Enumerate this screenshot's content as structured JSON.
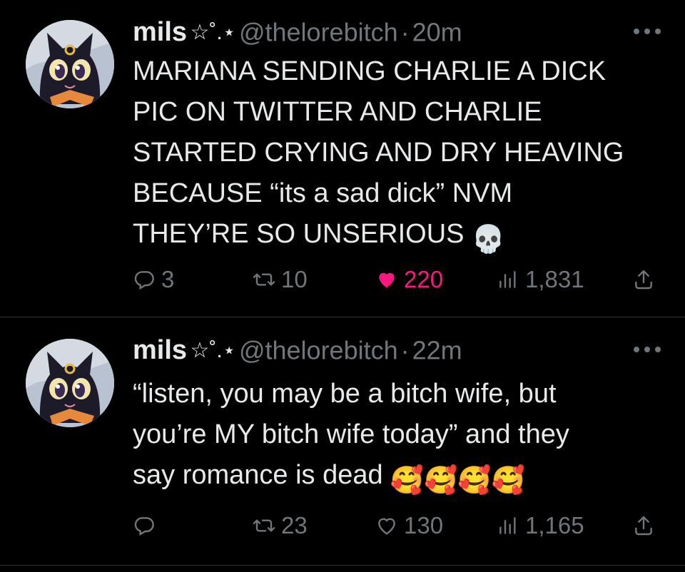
{
  "tweets": [
    {
      "display_name": "mils",
      "name_decor": "☆˚.⋆",
      "handle": "@thelorebitch",
      "time": "20m",
      "text": "MARIANA SENDING CHARLIE A DICK\nPIC ON TWITTER AND CHARLIE\nSTARTED CRYING AND DRY HEAVING\nBECAUSE “its a sad dick” NVM\nTHEY’RE SO UNSERIOUS",
      "emoji": "💀",
      "replies": "3",
      "retweets": "10",
      "likes": "220",
      "views": "1,831",
      "liked": true
    },
    {
      "display_name": "mils",
      "name_decor": "☆˚.⋆",
      "handle": "@thelorebitch",
      "time": "22m",
      "text": "“listen, you may be a bitch wife, but\nyou’re MY bitch wife today” and they\nsay romance is dead",
      "emoji": "🥰🥰🥰🥰",
      "replies": "",
      "retweets": "23",
      "likes": "130",
      "views": "1,165",
      "liked": false
    }
  ],
  "colors": {
    "background": "#000000",
    "text": "#e7e9ea",
    "muted": "#71767b",
    "like": "#f91880",
    "divider": "#2f3336"
  },
  "icons": {
    "reply": "reply-icon",
    "retweet": "retweet-icon",
    "like": "heart-icon",
    "views": "views-icon",
    "share": "share-icon",
    "more": "more-icon"
  }
}
